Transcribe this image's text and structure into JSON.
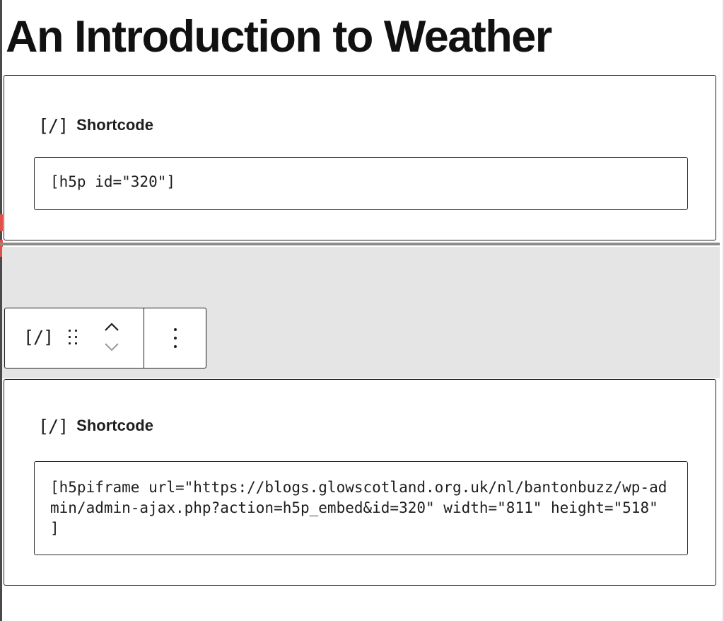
{
  "page": {
    "title": "An Introduction to Weather"
  },
  "blocks": [
    {
      "icon": "[/]",
      "label": "Shortcode",
      "value": "[h5p id=\"320\"]"
    },
    {
      "icon": "[/]",
      "label": "Shortcode",
      "value": "[h5piframe url=\"https://blogs.glowscotland.org.uk/nl/bantonbuzz/wp-admin/admin-ajax.php?action=h5p_embed&id=320\" width=\"811\" height=\"518\" ]"
    }
  ],
  "toolbar": {
    "block_type_icon": "[/]",
    "icons": {
      "drag": "drag-handle-icon",
      "up": "chevron-up-icon",
      "down": "chevron-down-icon",
      "more": "more-vertical-icon"
    }
  },
  "colors": {
    "text": "#1e1e1e",
    "insertion_zone": "#e5e5e5",
    "marker": "#e2504a"
  }
}
